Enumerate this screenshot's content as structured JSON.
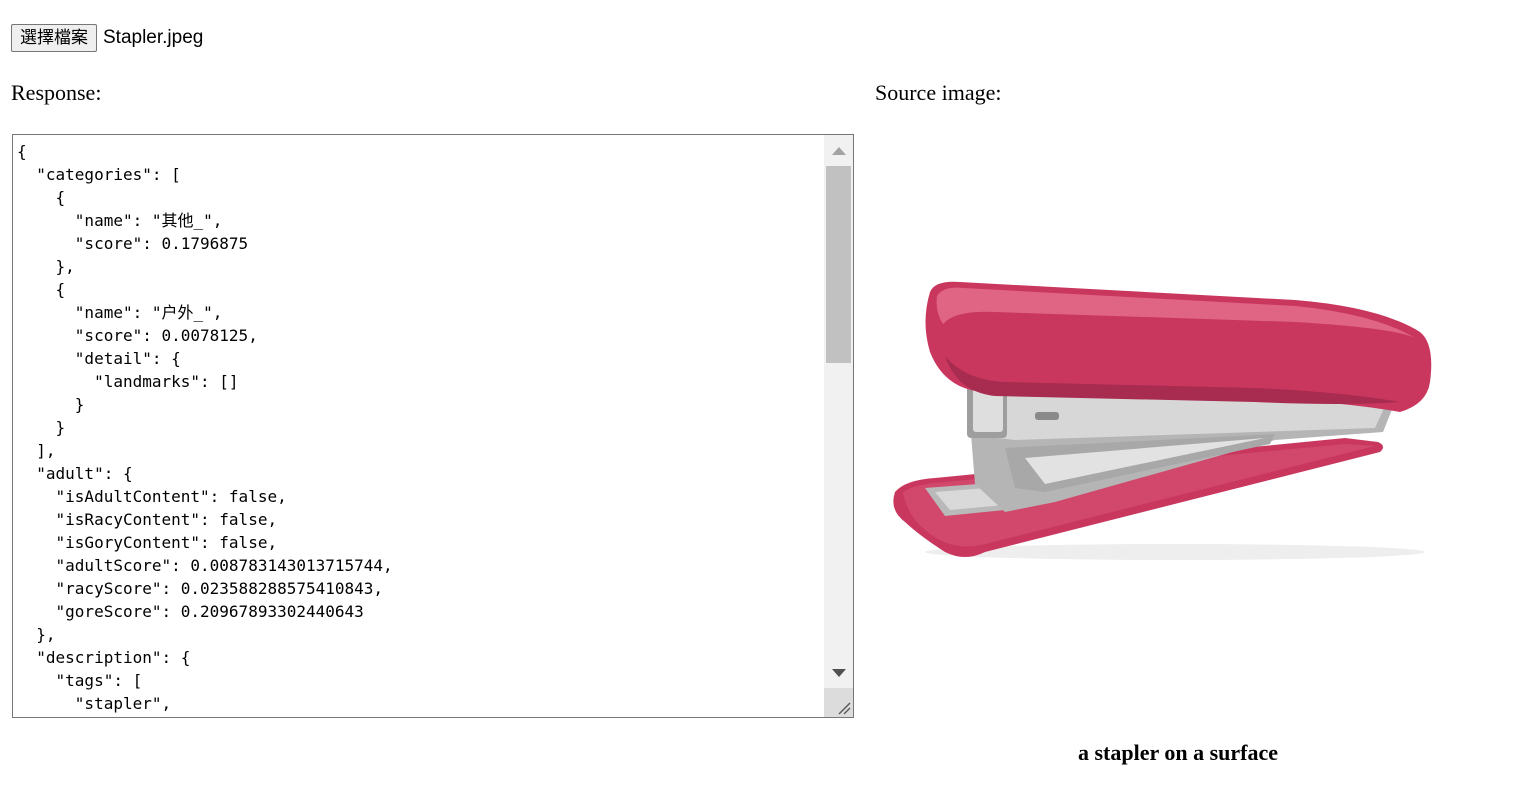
{
  "file_input": {
    "button_label": "選擇檔案",
    "file_name": "Stapler.jpeg"
  },
  "response": {
    "label": "Response:",
    "json_text": "{\n  \"categories\": [\n    {\n      \"name\": \"其他_\",\n      \"score\": 0.1796875\n    },\n    {\n      \"name\": \"户外_\",\n      \"score\": 0.0078125,\n      \"detail\": {\n        \"landmarks\": []\n      }\n    }\n  ],\n  \"adult\": {\n    \"isAdultContent\": false,\n    \"isRacyContent\": false,\n    \"isGoryContent\": false,\n    \"adultScore\": 0.008783143013715744,\n    \"racyScore\": 0.023588288575410843,\n    \"goreScore\": 0.20967893302440643\n  },\n  \"description\": {\n    \"tags\": [\n      \"stapler\","
  },
  "source": {
    "label": "Source image:",
    "caption": "a stapler on a surface",
    "image_subject": "pink stapler"
  },
  "colors": {
    "stapler_body": "#c9375f",
    "stapler_highlight": "#e06585",
    "metal": "#c8c8c8"
  }
}
